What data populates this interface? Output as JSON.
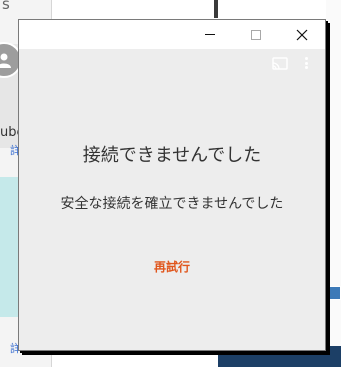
{
  "background": {
    "cut_char": "s",
    "avatar_text": "ube",
    "link_fragment_1": "詳",
    "link_fragment_2": "詳"
  },
  "window": {
    "error_title": "接続できませんでした",
    "error_message": "安全な接続を確立できませんでした",
    "retry_label": "再試行",
    "colors": {
      "retry": "#e0561d",
      "content_bg": "#ededed",
      "text": "#333333"
    },
    "icons": {
      "cast": "cast-icon",
      "more": "more-vert-icon",
      "minimize": "minimize-icon",
      "maximize": "maximize-icon",
      "close": "close-icon"
    }
  }
}
